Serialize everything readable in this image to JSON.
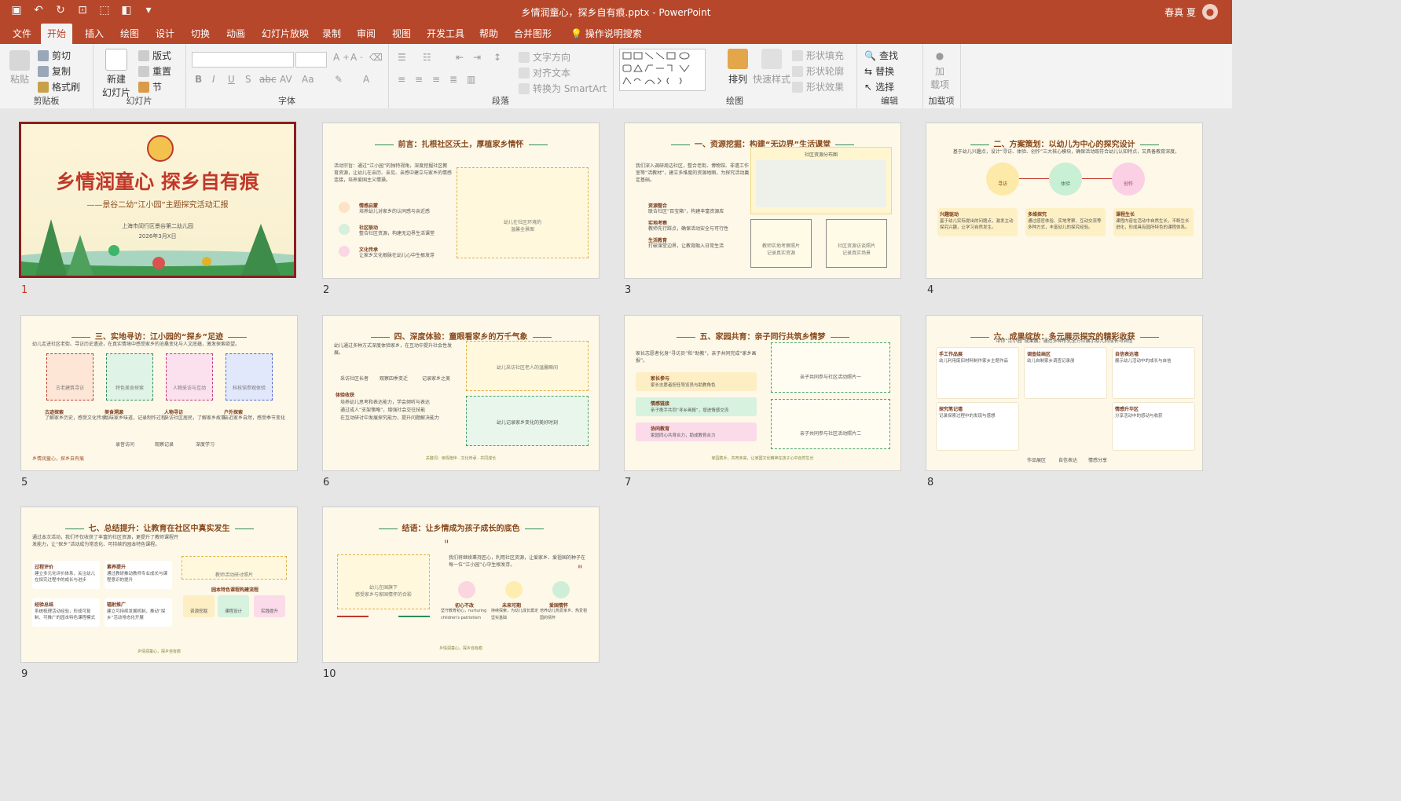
{
  "titlebar": {
    "title": "乡情润童心，探乡自有痕.pptx  -  PowerPoint",
    "user": "春真 夏",
    "avatar_icon": "user-icon"
  },
  "tabs": [
    "文件",
    "开始",
    "插入",
    "绘图",
    "设计",
    "切换",
    "动画",
    "幻灯片放映",
    "录制",
    "审阅",
    "视图",
    "开发工具",
    "帮助",
    "合并图形",
    "操作说明搜索"
  ],
  "ribbon": {
    "clipboard": {
      "paste": "粘贴",
      "cut": "剪切",
      "copy": "复制",
      "format_painter": "格式刷",
      "label": "剪贴板"
    },
    "slides": {
      "new_slide": "新建\n幻灯片",
      "layout": "版式",
      "reset": "重置",
      "section": "节",
      "label": "幻灯片"
    },
    "font": {
      "label": "字体",
      "bold": "B",
      "italic": "I",
      "underline": "U",
      "shadow": "S",
      "strike": "abc",
      "spacing": "AV",
      "case": "Aa"
    },
    "paragraph": {
      "label": "段落",
      "text_direction": "文字方向",
      "align_text": "对齐文本",
      "convert_smartart": "转换为 SmartArt"
    },
    "drawing": {
      "label": "绘图",
      "arrange": "排列",
      "quick_styles": "快速样式",
      "shape_fill": "形状填充",
      "shape_outline": "形状轮廓",
      "shape_effects": "形状效果"
    },
    "editing": {
      "label": "编辑",
      "find": "查找",
      "replace": "替换",
      "select": "选择"
    },
    "addins": {
      "label": "加载项",
      "addins": "加\n载项"
    }
  },
  "slides": [
    {
      "num": "1",
      "title": "乡情润童心 探乡自有痕",
      "subtitle": "——景谷二幼“江小园”主题探究活动汇报",
      "org": "上海市闵行区景谷第二幼儿园",
      "date": "2026年3月X日"
    },
    {
      "num": "2",
      "title": "前言：扎根社区沃土，厚植家乡情怀",
      "intro": "活动宗旨：通过“江小园”的独特视角，深度挖掘社区教育资源，让幼儿在亲历、亲见、亲感中建立与家乡的情感连接，培养爱国主义情操。",
      "items": [
        {
          "h": "情感启蒙",
          "t": "培养幼儿对家乡的认同感与亲近感"
        },
        {
          "h": "社区联动",
          "t": "整合社区资源，构建无边界生活课堂"
        },
        {
          "h": "文化传承",
          "t": "让家乡文化根脉在幼儿心中生根发芽"
        }
      ],
      "placeholder": "幼儿在社区环境的\n温馨全景图"
    },
    {
      "num": "3",
      "title": "一、资源挖掘：构建“无边界”生活课堂",
      "intro": "我们深入调研周边社区，整合老街、博物馆、非遗工作室等“活教材”，建立多维度的资源地图，为探究活动奠定基础。",
      "map_title": "社区资源分布图",
      "items": [
        {
          "h": "资源整合",
          "t": "联合社区“百宝箱”，构建丰富资源库"
        },
        {
          "h": "实地考察",
          "t": "教师先行踩点，确保活动安全与可行性"
        },
        {
          "h": "生活教育",
          "t": "打破课堂边界，让教育融入日常生活"
        }
      ],
      "ph1": "教师实地考察照片\n记录真实资源",
      "ph2": "社区资源访谈照片\n记录真实场景"
    },
    {
      "num": "4",
      "title": "二、方案策划：以幼儿为中心的探究设计",
      "intro": "基于幼儿兴趣点，设计“寻访、体验、创作”三大核心模块，确保活动既符合幼儿认知特点，又具备教育深度。",
      "modules": [
        "寻访",
        "体验",
        "创作"
      ],
      "cards": [
        {
          "h": "兴趣驱动",
          "t": "基于幼儿实际提出的问题点，激发主动探究兴趣，让学习自然发生。"
        },
        {
          "h": "多维探究",
          "t": "通过感官体验、实地考察、互动交流等多种方式，丰富幼儿的探究经验。"
        },
        {
          "h": "课程生长",
          "t": "课程内容在活动中自然生长，不断生长进化，形成具有园所特色的课程体系。"
        }
      ]
    },
    {
      "num": "5",
      "title": "三、实地寻访：江小园的“探乡”足迹",
      "intro": "幼儿走进社区老街、寻访历史遗迹，在真实情境中感受家乡的沧桑变化与人文底蕴，激发探索欲望。",
      "places": [
        "古老建筑寻访",
        "特色美食探索",
        "人物采访与互动",
        "科技馆参观体验"
      ],
      "notes": [
        {
          "h": "古迹探索",
          "t": "了解家乡历史，感受文化传承"
        },
        {
          "h": "美食溯源",
          "t": "品味家乡味道，记录制作过程"
        },
        {
          "h": "人物寻访",
          "t": "采访社区居民，了解家乡故事"
        },
        {
          "h": "户外探索",
          "t": "亲近家乡自然，感受季节变化"
        }
      ],
      "tags": [
        "录音访问",
        "观察记录",
        "深度学习"
      ],
      "footer": "乡情润童心，探乡自有痕"
    },
    {
      "num": "6",
      "title": "四、深度体验：童眼看家乡的万千气象",
      "intro": "幼儿通过多种方式深度体验家乡，在互动中提升社会性发展。",
      "icons": [
        "采访社区长者",
        "观察四季变迁",
        "记录家乡之美"
      ],
      "gains_title": "体验收获",
      "gains": [
        "培养幼儿思考和表达能力，学会倾听与表达",
        "通过成人“支架策略”，增强社会交往技能",
        "在互动研讨中发展探究能力，提升问题解决能力"
      ],
      "ph1": "幼儿采访社区老人的温馨瞬间",
      "ph2": "幼儿记录家乡变化的美好时刻",
      "footer": "关键词：亲情陪伴 · 文化传承 · 共同成长"
    },
    {
      "num": "7",
      "title": "五、家园共育：亲子同行共筑乡情梦",
      "intro": "家长志愿者化身“寻访员”和“助教”，亲子共同完成“家乡画报”。",
      "cards": [
        {
          "h": "家长参与",
          "t": "家长志愿者担任导览员与助教角色"
        },
        {
          "h": "情感链接",
          "t": "亲子携手共同“寻乡画报”，增进情感交流"
        },
        {
          "h": "协同教育",
          "t": "家园同心共育合力，助成教育合力"
        }
      ],
      "ph1": "亲子共同参与社区活动照片一",
      "ph2": "亲子共同参与社区活动照片二",
      "quote": "家园携手，共育未来，让家国文化精神在孩子心中自然生长"
    },
    {
      "num": "8",
      "title": "六、成果绽放：多元展示探究的精彩收获",
      "intro": "带你“江小园”成果展，通过多种形式全方位展示幼儿的成长与自信",
      "cards": [
        {
          "h": "手工作品展",
          "t": "幼儿利用废旧材料制作家乡主题作品"
        },
        {
          "h": "调查绘画区",
          "t": "幼儿自制家乡调查记录册"
        },
        {
          "h": "自信表达墙",
          "t": "展示幼儿活动中的成长与自信"
        },
        {
          "h": "探究笔记墙",
          "t": "记录探索过程中的发现与感想"
        },
        {
          "h": "情感升华区",
          "t": "分享活动中的感动与收获"
        }
      ],
      "tags": [
        "作品展区",
        "自信表达",
        "情感分享"
      ]
    },
    {
      "num": "9",
      "title": "七、总结提升：让教育在社区中真实发生",
      "intro": "通过本次活动，我们不仅收获了丰富的社区资源，更提升了教师课程开发能力，让“探乡”活动成为常态化、可持续的园本特色课程。",
      "cards": [
        {
          "h": "过程评价",
          "t": "建立多元化评价体系，关注幼儿在探究过程中的成长与进步"
        },
        {
          "h": "素养提升",
          "t": "通过教研推动教师专业成长与课程意识的提升"
        },
        {
          "h": "经验总结",
          "t": "系统梳理活动经验，形成可复制、可推广的园本特色课程模式"
        },
        {
          "h": "辐射推广",
          "t": "建立可持续发展机制，推动“探乡”活动常态化开展"
        }
      ],
      "ph": "教师活动研讨照片",
      "flow_title": "园本特色课程构建流程",
      "flow": [
        "资源挖掘",
        "课程设计",
        "实践提升"
      ],
      "footer": "乡情润童心，探乡自有痕"
    },
    {
      "num": "10",
      "title": "结语：让乡情成为孩子成长的底色",
      "ph": "幼儿在国旗下\n感受家乡与家国情怀的合影",
      "text": "我们将继续秉持匠心，利用社区资源，让爱家乡、爱祖国的种子在每一位“江小园”心中生根发芽。",
      "values": [
        {
          "h": "初心不改",
          "t": "坚守教育初心，nurturing children's patriotism"
        },
        {
          "h": "未来可期",
          "t": "持续探索，为幼儿成长奠定坚实基础"
        },
        {
          "h": "爱国情怀",
          "t": "培养幼儿热爱家乡、热爱祖国的情怀"
        }
      ],
      "footer": "乡情润童心，探乡自有痕"
    }
  ]
}
